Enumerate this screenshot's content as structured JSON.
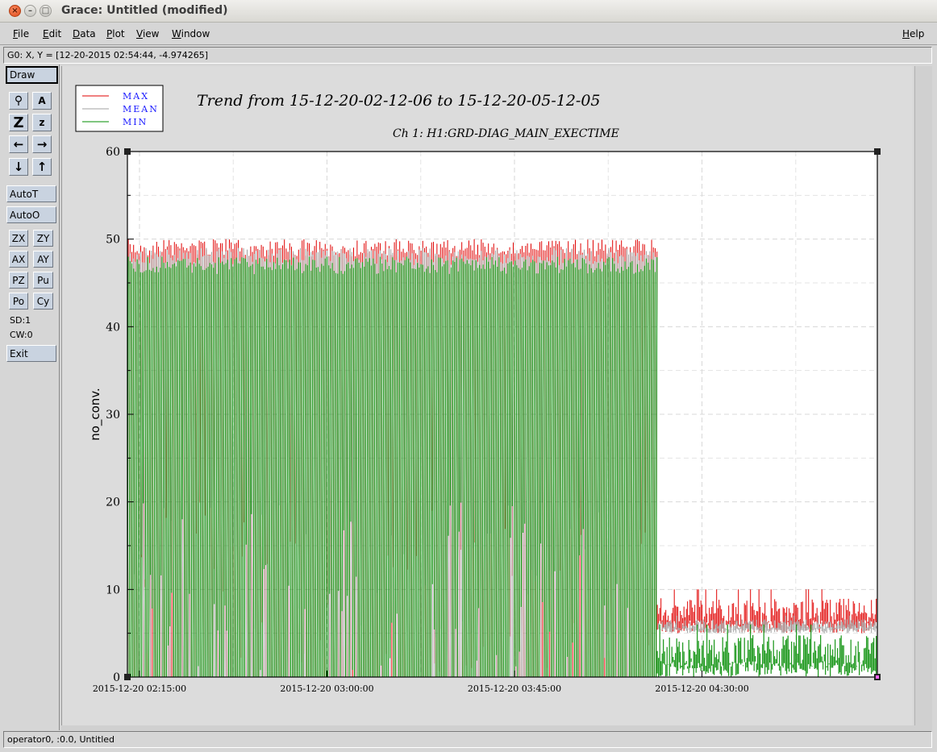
{
  "window": {
    "title": "Grace: Untitled (modified)",
    "close_glyph": "×",
    "min_glyph": "–",
    "max_glyph": "□"
  },
  "menu": {
    "items": [
      {
        "label": "File",
        "key": "F",
        "rest": "ile"
      },
      {
        "label": "Edit",
        "key": "E",
        "rest": "dit"
      },
      {
        "label": "Data",
        "key": "D",
        "rest": "ata"
      },
      {
        "label": "Plot",
        "key": "P",
        "rest": "lot"
      },
      {
        "label": "View",
        "key": "V",
        "rest": "iew"
      },
      {
        "label": "Window",
        "key": "W",
        "rest": "indow"
      }
    ],
    "help": {
      "label": "Help",
      "key": "H",
      "rest": "elp"
    }
  },
  "locator": {
    "text": "G0: X, Y = [12-20-2015 02:54:44, -4.974265]"
  },
  "toolbar": {
    "draw": "Draw",
    "zoom_glyph": "⚲",
    "autoscale_text_glyph": "A",
    "z_large": "Z",
    "z_small": "z",
    "left_arrow": "←",
    "right_arrow": "→",
    "down_arrow": "↓",
    "up_arrow": "↑",
    "autot": "AutoT",
    "autoo": "AutoO",
    "zx": "ZX",
    "zy": "ZY",
    "ax": "AX",
    "ay": "AY",
    "pz": "PZ",
    "pu": "Pu",
    "po": "Po",
    "cy": "Cy",
    "sd": "SD:1",
    "cw": "CW:0",
    "exit": "Exit"
  },
  "status": {
    "text": "operator0, :0.0, Untitled"
  },
  "chart_data": {
    "type": "line",
    "title": "Trend from 15-12-20-02-12-06 to 15-12-20-05-12-05",
    "subtitle": "Ch 1: H1:GRD-DIAG_MAIN_EXECTIME",
    "xlabel": "",
    "ylabel": "no_conv.",
    "x_ticks": [
      "2015-12-20 02:15:00",
      "2015-12-20 03:00:00",
      "2015-12-20 03:45:00",
      "2015-12-20 04:30:00"
    ],
    "x_range": [
      "2015-12-20 02:12:06",
      "2015-12-20 05:12:05"
    ],
    "ylim": [
      0,
      60
    ],
    "y_ticks": [
      0,
      10,
      20,
      30,
      40,
      50,
      60
    ],
    "grid": true,
    "legend_position": "top-left",
    "series": [
      {
        "name": "MAX",
        "color": "#e00000",
        "segments": [
          {
            "from": "2015-12-20 02:12:06",
            "to": "2015-12-20 04:19:00",
            "min": 0,
            "max": 50,
            "pattern": "oscillating"
          },
          {
            "from": "2015-12-20 04:19:00",
            "to": "2015-12-20 05:12:05",
            "min": 5,
            "max": 10,
            "pattern": "steady"
          }
        ]
      },
      {
        "name": "MEAN",
        "color": "#a0a0a0",
        "segments": [
          {
            "from": "2015-12-20 02:12:06",
            "to": "2015-12-20 04:19:00",
            "min": 0,
            "max": 49,
            "pattern": "oscillating"
          },
          {
            "from": "2015-12-20 04:19:00",
            "to": "2015-12-20 05:12:05",
            "min": 5,
            "max": 7,
            "pattern": "steady"
          }
        ]
      },
      {
        "name": "MIN",
        "color": "#008c00",
        "segments": [
          {
            "from": "2015-12-20 02:12:06",
            "to": "2015-12-20 04:19:00",
            "min": 0,
            "max": 48,
            "pattern": "oscillating"
          },
          {
            "from": "2015-12-20 04:19:00",
            "to": "2015-12-20 05:12:05",
            "min": 0,
            "max": 6,
            "pattern": "steady"
          }
        ]
      }
    ]
  }
}
